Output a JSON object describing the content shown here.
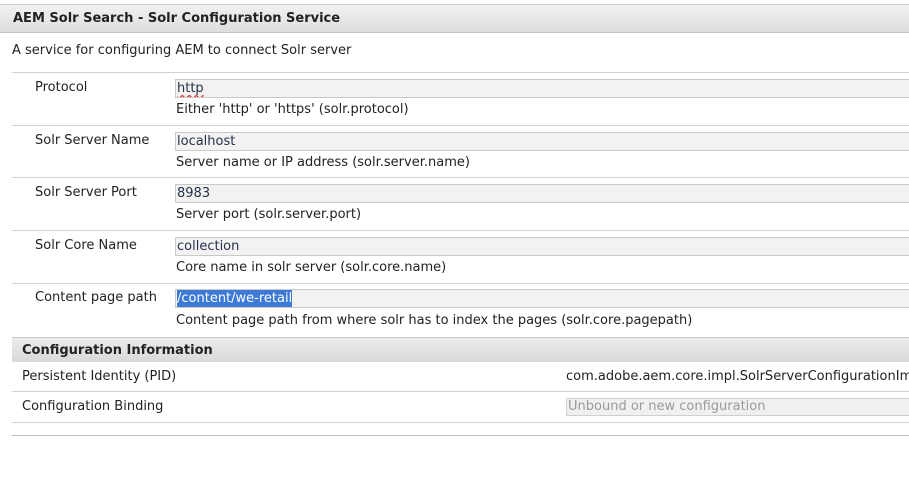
{
  "header": {
    "title": "AEM Solr Search - Solr Configuration Service"
  },
  "description": "A service for configuring AEM to connect Solr server",
  "fields": [
    {
      "label": "Protocol",
      "value": "http",
      "hint": "Either 'http' or 'https' (solr.protocol)"
    },
    {
      "label": "Solr Server Name",
      "value": "localhost",
      "hint": "Server name or IP address (solr.server.name)"
    },
    {
      "label": "Solr Server Port",
      "value": "8983",
      "hint": "Server port (solr.server.port)"
    },
    {
      "label": "Solr Core Name",
      "value": "collection",
      "hint": "Core name in solr server (solr.core.name)"
    },
    {
      "label": "Content page path",
      "value": "/content/we-retail",
      "hint": "Content page path from where solr has to index the pages (solr.core.pagepath)"
    }
  ],
  "config_info": {
    "heading": "Configuration Information",
    "pid_label": "Persistent Identity (PID)",
    "pid_value": "com.adobe.aem.core.impl.SolrServerConfigurationIm",
    "binding_label": "Configuration Binding",
    "binding_value": "Unbound or new configuration"
  },
  "colors": {
    "selection": "#3d7ad6",
    "field_bg": "#f2f2f2",
    "header_bg": "#e4e4e4"
  }
}
